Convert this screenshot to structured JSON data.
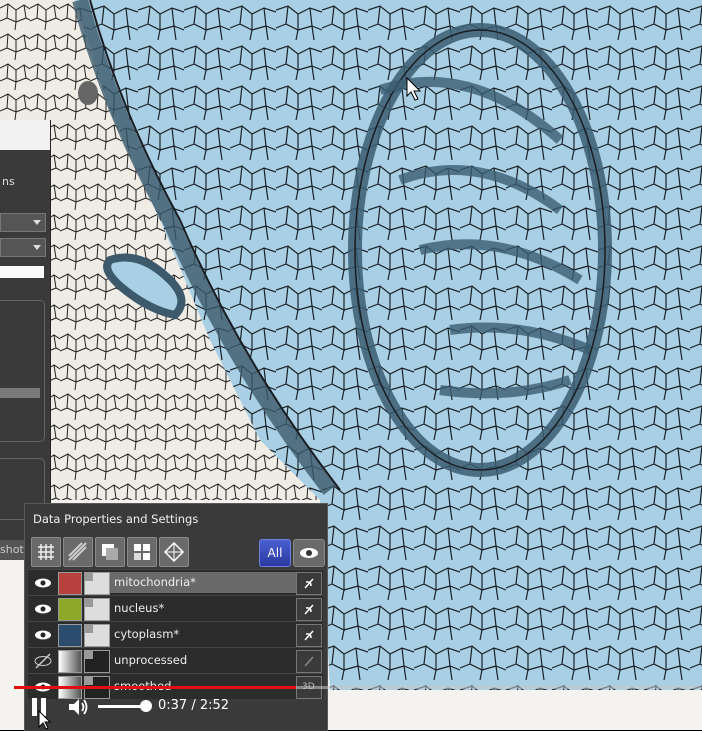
{
  "panel": {
    "title": "Data Properties and Settings",
    "all_label": "All",
    "layers": [
      {
        "name": "mitochondria*",
        "color": "#b8403f",
        "visible": true,
        "selected": true
      },
      {
        "name": "nucleus*",
        "color": "#8ea92a",
        "visible": true,
        "selected": false
      },
      {
        "name": "cytoplasm*",
        "color": "#2c4c6e",
        "visible": true,
        "selected": false
      },
      {
        "name": "unprocessed",
        "color": "#888888",
        "visible": false,
        "selected": false
      },
      {
        "name": "smoothed",
        "color": "#777777",
        "visible": true,
        "selected": false
      }
    ],
    "row5_badge": "3D"
  },
  "left_panel": {
    "fragment_text": "ns",
    "shot_label": "shot"
  },
  "video": {
    "time": "0:37 / 2:52",
    "progress_fraction": 0.41,
    "volume_fraction": 1.0
  },
  "colors": {
    "overlay": "#9cc8e0",
    "outline": "#1a1e22",
    "background_tissue": "#f0ede8",
    "progress": "#e01010",
    "all_button": "#3a4dc0"
  }
}
